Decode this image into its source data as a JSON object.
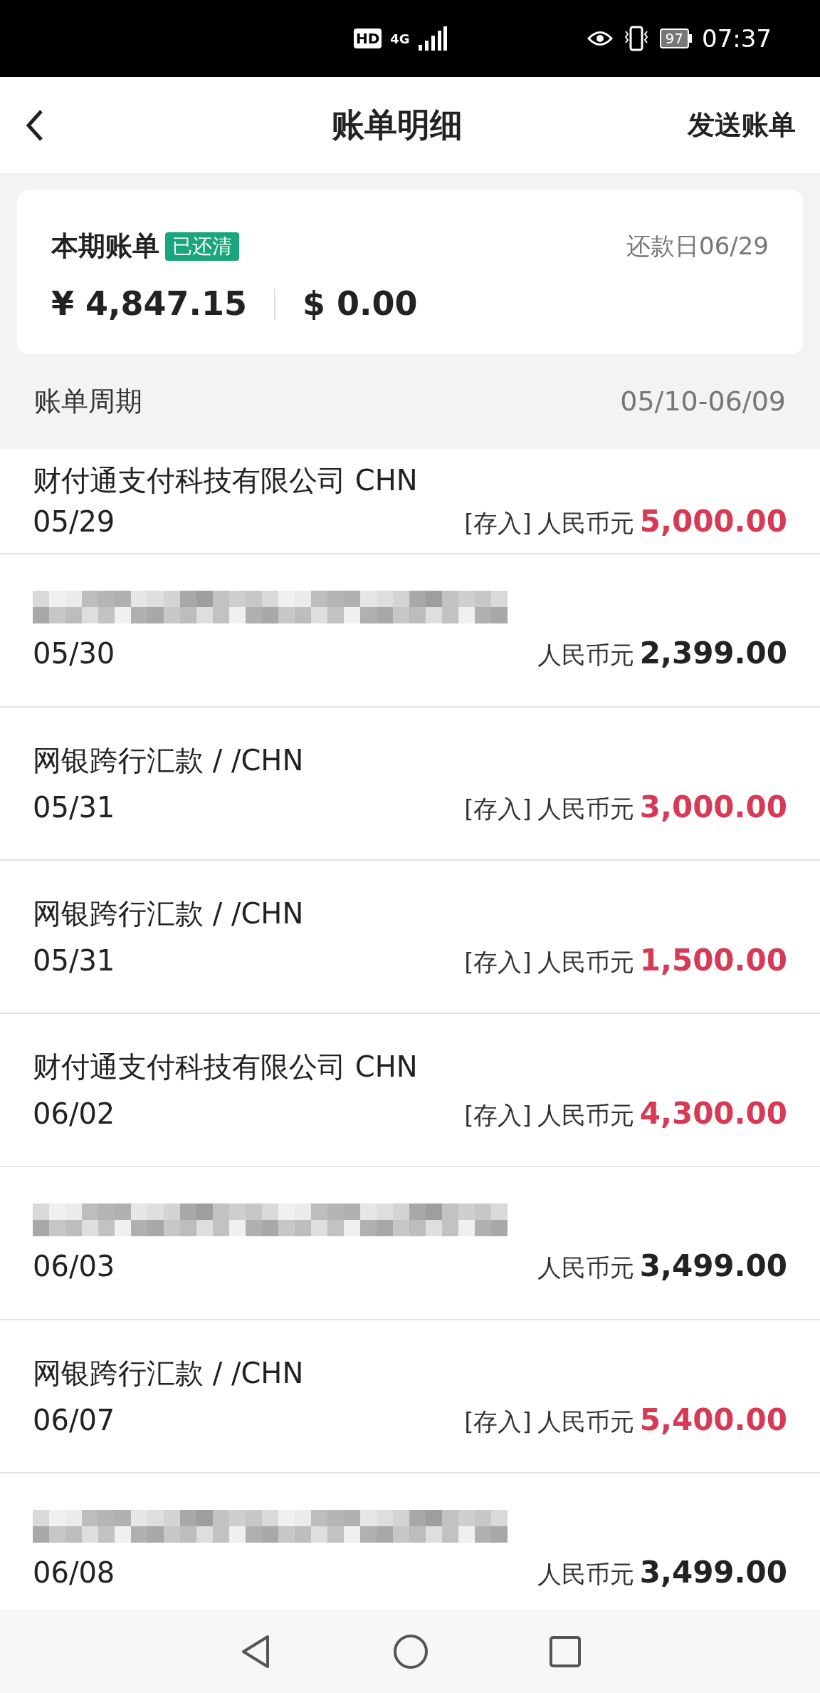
{
  "status_bar": {
    "hd": "HD",
    "network": "4G",
    "battery": "97",
    "time": "07:37"
  },
  "header": {
    "title": "账单明细",
    "action": "发送账单"
  },
  "summary": {
    "title": "本期账单",
    "badge": "已还清",
    "due": "还款日06/29",
    "cny": "¥ 4,847.15",
    "usd": "$ 0.00"
  },
  "period": {
    "label": "账单周期",
    "range": "05/10-06/09"
  },
  "transactions": [
    {
      "kind": "deposit",
      "description": "财付通支付科技有限公司 CHN",
      "date": "05/29",
      "tag": "[存入]",
      "currency": "人民币元",
      "amount": "5,000.00"
    },
    {
      "kind": "spend",
      "hidden": true,
      "date": "05/30",
      "currency": "人民币元",
      "amount": "2,399.00"
    },
    {
      "kind": "deposit",
      "description": "网银跨行汇款 / /CHN",
      "date": "05/31",
      "tag": "[存入]",
      "currency": "人民币元",
      "amount": "3,000.00"
    },
    {
      "kind": "deposit",
      "description": "网银跨行汇款 / /CHN",
      "date": "05/31",
      "tag": "[存入]",
      "currency": "人民币元",
      "amount": "1,500.00"
    },
    {
      "kind": "deposit",
      "description": "财付通支付科技有限公司 CHN",
      "date": "06/02",
      "tag": "[存入]",
      "currency": "人民币元",
      "amount": "4,300.00"
    },
    {
      "kind": "spend",
      "hidden": true,
      "date": "06/03",
      "currency": "人民币元",
      "amount": "3,499.00"
    },
    {
      "kind": "deposit",
      "description": "网银跨行汇款 / /CHN",
      "date": "06/07",
      "tag": "[存入]",
      "currency": "人民币元",
      "amount": "5,400.00"
    },
    {
      "kind": "spend",
      "hidden": true,
      "date": "06/08",
      "currency": "人民币元",
      "amount": "3,499.00"
    }
  ]
}
